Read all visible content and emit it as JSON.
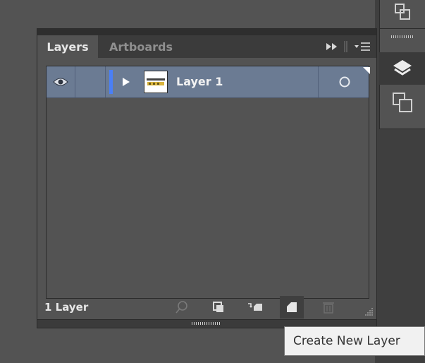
{
  "panel": {
    "tabs": [
      {
        "label": "Layers",
        "active": true
      },
      {
        "label": "Artboards",
        "active": false
      }
    ],
    "menu_icons": [
      "fast-forward-icon",
      "panel-menu-icon"
    ]
  },
  "layers": [
    {
      "name": "Layer 1",
      "visible": true,
      "color": "#4a7ff7",
      "thumbnail_icon": "artwork-thumbnail"
    }
  ],
  "footer": {
    "count_label": "1 Layer",
    "buttons": [
      {
        "name": "locate-object-button",
        "icon": "search-icon",
        "enabled": false
      },
      {
        "name": "make-clipping-mask-button",
        "icon": "clipping-mask-icon",
        "enabled": true
      },
      {
        "name": "create-sublayer-button",
        "icon": "sublayer-icon",
        "enabled": true
      },
      {
        "name": "create-new-layer-button",
        "icon": "new-layer-icon",
        "enabled": true,
        "hovered": true
      },
      {
        "name": "delete-layer-button",
        "icon": "trash-icon",
        "enabled": false
      }
    ]
  },
  "tooltip": {
    "text": "Create New Layer"
  },
  "dock": {
    "icons": [
      "artboards-icon",
      "layers-icon",
      "artboards-panel-icon"
    ],
    "active": "layers-icon"
  },
  "colors": {
    "panel_bg": "#535353",
    "selected_row": "#6b7b93",
    "layer_color": "#4a7ff7",
    "tooltip_bg": "#f1f1f1"
  }
}
